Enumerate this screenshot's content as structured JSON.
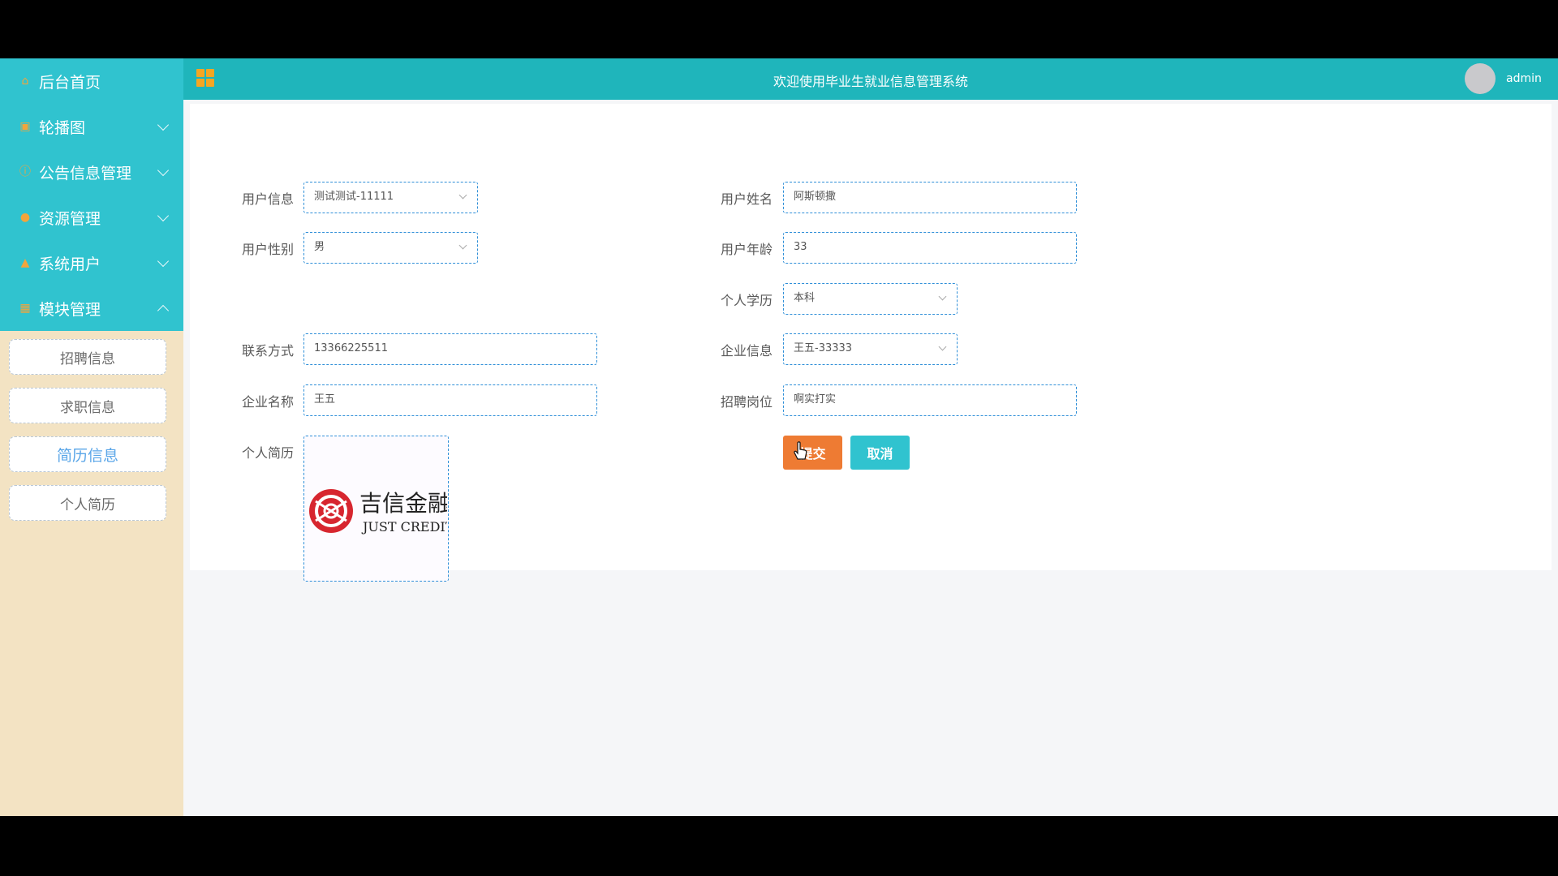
{
  "sidebar": {
    "items": [
      {
        "label": "后台首页",
        "icon": "home-icon",
        "glyph": "⌂",
        "chevron": "none"
      },
      {
        "label": "轮播图",
        "icon": "image-icon",
        "glyph": "▣",
        "chevron": "down"
      },
      {
        "label": "公告信息管理",
        "icon": "info-icon",
        "glyph": "ⓘ",
        "chevron": "down"
      },
      {
        "label": "资源管理",
        "icon": "location-icon",
        "glyph": "●",
        "chevron": "down"
      },
      {
        "label": "系统用户",
        "icon": "user-icon",
        "glyph": "▲",
        "chevron": "down"
      },
      {
        "label": "模块管理",
        "icon": "grid-icon",
        "glyph": "▦",
        "chevron": "up"
      }
    ],
    "submenu": [
      "招聘信息",
      "求职信息",
      "简历信息",
      "个人简历"
    ],
    "active_submenu": "简历信息"
  },
  "header": {
    "title": "欢迎使用毕业生就业信息管理系统",
    "user": "admin"
  },
  "form": {
    "user_info": {
      "label": "用户信息",
      "value": "测试测试-11111"
    },
    "user_name": {
      "label": "用户姓名",
      "value": "阿斯顿撒"
    },
    "user_gender": {
      "label": "用户性别",
      "value": "男"
    },
    "user_age": {
      "label": "用户年龄",
      "value": "33"
    },
    "education": {
      "label": "个人学历",
      "value": "本科"
    },
    "contact": {
      "label": "联系方式",
      "value": "13366225511"
    },
    "company_info": {
      "label": "企业信息",
      "value": "王五-33333"
    },
    "company_name": {
      "label": "企业名称",
      "value": "王五"
    },
    "job_post": {
      "label": "招聘岗位",
      "value": "啊实打实"
    },
    "resume": {
      "label": "个人简历"
    }
  },
  "resume_image": {
    "brand_cn": "吉信金融",
    "brand_en": "JUST CREDIT"
  },
  "buttons": {
    "submit": "提交",
    "cancel": "取消"
  },
  "colors": {
    "teal": "#1fb5bb",
    "sidebar_teal": "#30c3cf",
    "sidebar_bg": "#f3e3c3",
    "submit": "#ee7b33",
    "accent_icon": "#f5a623"
  }
}
